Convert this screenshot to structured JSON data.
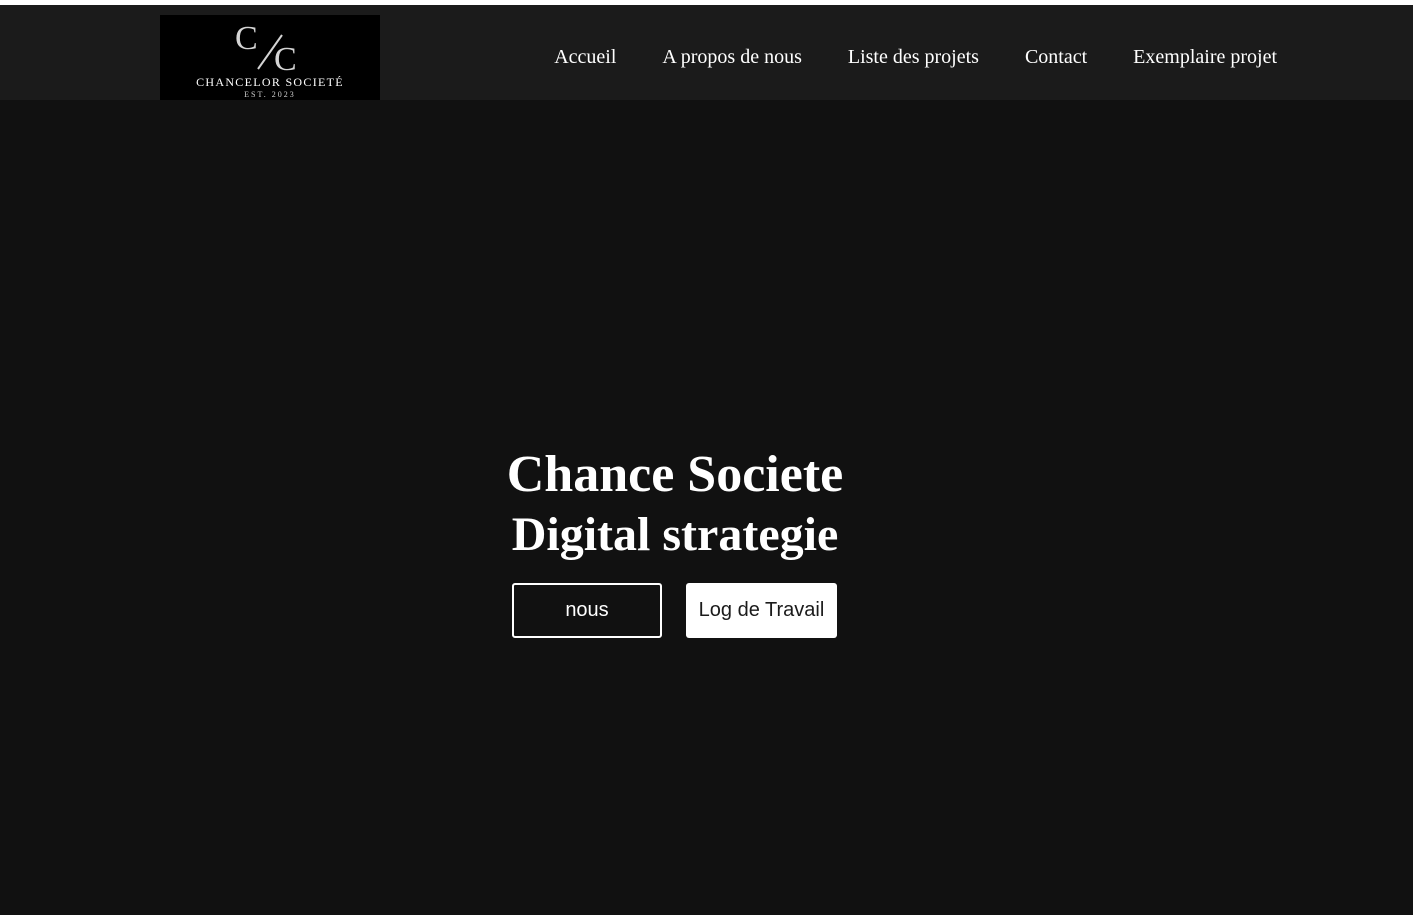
{
  "brand": {
    "monogram_top": "C",
    "monogram_bottom": "C",
    "name": "CHANCELOR SOCIETÉ",
    "established": "EST. 2023"
  },
  "nav": {
    "items": [
      {
        "label": "Accueil"
      },
      {
        "label": "A propos de nous"
      },
      {
        "label": "Liste des projets"
      },
      {
        "label": "Contact"
      },
      {
        "label": "Exemplaire projet"
      }
    ]
  },
  "hero": {
    "title": "Chance Societe",
    "subtitle": "Digital strategie",
    "primary_button": "nous",
    "secondary_button": "Log de Travail"
  },
  "colors": {
    "page_background": "#111111",
    "navbar_background": "#1b1b1b",
    "logo_background": "#000000",
    "text": "#ffffff"
  }
}
